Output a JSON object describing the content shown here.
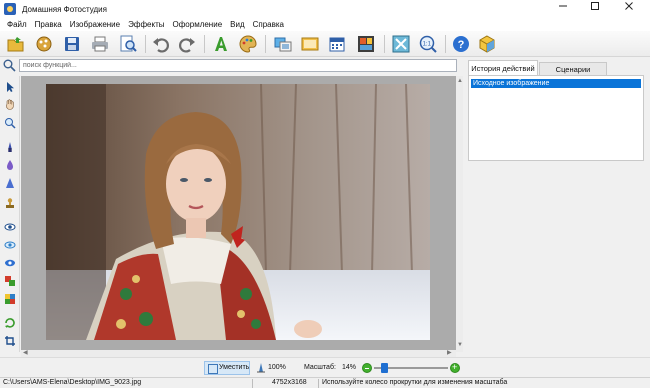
{
  "window": {
    "title": "Домашняя Фотостудия",
    "controls": [
      "minimize",
      "maximize",
      "close"
    ]
  },
  "menu": {
    "items": [
      "Файл",
      "Правка",
      "Изображение",
      "Эффекты",
      "Оформление",
      "Вид",
      "Справка"
    ]
  },
  "toolbar": {
    "buttons": [
      "open-icon",
      "catalog-icon",
      "save-icon",
      "print-icon",
      "preview-icon",
      "undo-icon",
      "redo-icon",
      "text-icon",
      "palette-icon",
      "frame-icon",
      "postcard-icon",
      "calendar-icon",
      "collage-icon",
      "fullscreen-icon",
      "actual-size-icon",
      "help-icon",
      "cube-icon"
    ]
  },
  "search": {
    "placeholder": "поиск функций...",
    "value": ""
  },
  "tools": [
    "pointer-icon",
    "hand-icon",
    "zoom-icon",
    "brush-icon",
    "blur-icon",
    "sharpen-icon",
    "stamp-icon",
    "eye-icon",
    "red-eye-icon",
    "lens-icon",
    "layers-icon",
    "color-replace-icon",
    "crop-icon",
    "rotate-icon"
  ],
  "panel": {
    "tabs": [
      "История действий",
      "Сценарии"
    ],
    "active_tab": 0,
    "history": [
      "Исходное изображение"
    ]
  },
  "zoom": {
    "fit_label": "Уместить",
    "actual_label": "100%",
    "scale_label": "Масштаб:",
    "scale_value": "14%",
    "slider_level": 0.14
  },
  "status": {
    "file_path": "C:\\Users\\AMS-Elena\\Desktop\\IMG_9023.jpg",
    "dimensions": "4752x3168",
    "hint": "Используйте колесо прокрутки для изменения масштаба"
  },
  "colors": {
    "accent": "#0a74d8",
    "canvas_bg": "#ababab",
    "zoom_button": "#42b02d"
  }
}
